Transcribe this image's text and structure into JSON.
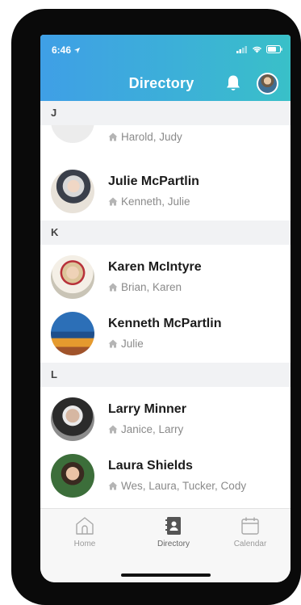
{
  "status": {
    "time": "6:46"
  },
  "header": {
    "title": "Directory"
  },
  "sections": [
    {
      "letter": "J",
      "partial_household": "Harold, Judy",
      "rows": [
        {
          "name": "Julie McPartlin",
          "household": "Kenneth, Julie"
        }
      ]
    },
    {
      "letter": "K",
      "rows": [
        {
          "name": "Karen McIntyre",
          "household": "Brian, Karen"
        },
        {
          "name": "Kenneth McPartlin",
          "household": "Julie"
        }
      ]
    },
    {
      "letter": "L",
      "rows": [
        {
          "name": "Larry Minner",
          "household": "Janice, Larry"
        },
        {
          "name": "Laura Shields",
          "household": "Wes, Laura, Tucker, Cody"
        }
      ]
    }
  ],
  "tabbar": {
    "home": "Home",
    "directory": "Directory",
    "calendar": "Calendar",
    "active": "directory"
  },
  "colors": {
    "header_start": "#3f9fe6",
    "header_end": "#39c0c8"
  },
  "icons": [
    "location-arrow-icon",
    "signal-icon",
    "wifi-icon",
    "battery-icon",
    "bell-icon",
    "house-icon",
    "home-tab-icon",
    "directory-tab-icon",
    "calendar-tab-icon"
  ]
}
